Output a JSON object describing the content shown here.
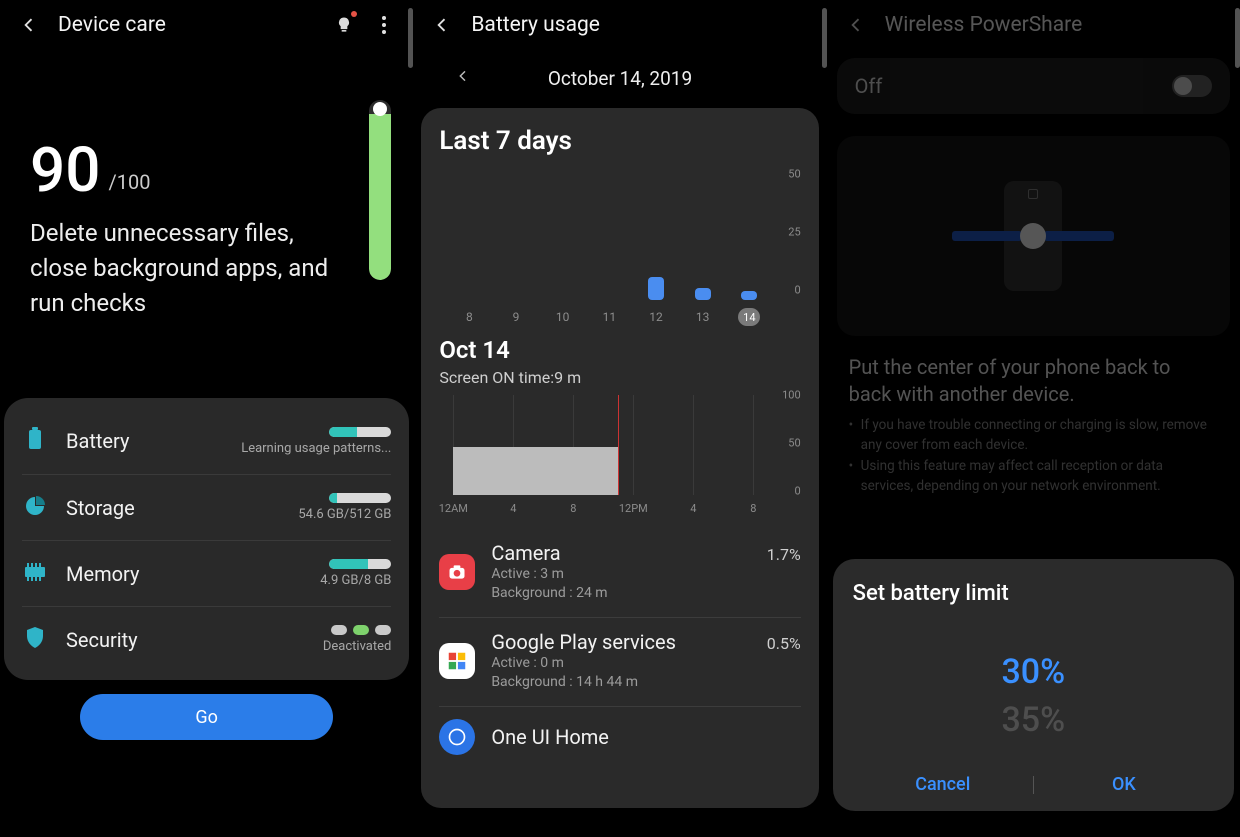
{
  "pane1": {
    "title": "Device care",
    "score": "90",
    "score_denominator": "/100",
    "advice": "Delete unnecessary files, close background apps, and run checks",
    "pill_pct": 92,
    "rows": {
      "battery": {
        "label": "Battery",
        "sub": "Learning usage patterns...",
        "bar_pct": 45
      },
      "storage": {
        "label": "Storage",
        "sub": "54.6 GB/512 GB",
        "bar_pct": 12
      },
      "memory": {
        "label": "Memory",
        "sub": "4.9 GB/8 GB",
        "bar_pct": 62
      },
      "security": {
        "label": "Security",
        "sub": "Deactivated"
      }
    },
    "go": "Go"
  },
  "pane2": {
    "title": "Battery usage",
    "date": "October 14, 2019",
    "section": "Last 7 days",
    "day_title": "Oct 14",
    "screen_on": "Screen ON time:9 m",
    "apps": [
      {
        "name": "Camera",
        "active": "Active : 3 m",
        "bg": "Background : 24 m",
        "pct": "1.7%",
        "color": "#e83f47",
        "icon": "camera"
      },
      {
        "name": "Google Play services",
        "active": "Active : 0 m",
        "bg": "Background : 14 h 44 m",
        "pct": "0.5%",
        "color": "#fff",
        "icon": "play"
      },
      {
        "name": "One UI Home",
        "active": "",
        "bg": "",
        "pct": "",
        "color": "#2b74e6",
        "icon": "home"
      }
    ]
  },
  "pane3": {
    "title": "Wireless PowerShare",
    "toggle_state": "Off",
    "desc_main": "Put the center of your phone back to back with another device.",
    "desc_list": [
      "If you have trouble connecting or charging is slow, remove any cover from each device.",
      "Using this feature may affect call reception or data services, depending on your network environment."
    ],
    "sheet": {
      "title": "Set battery limit",
      "selected": "30%",
      "next": "35%",
      "cancel": "Cancel",
      "ok": "OK"
    }
  },
  "chart_data": [
    {
      "type": "bar",
      "title": "Last 7 days",
      "categories": [
        "8",
        "9",
        "10",
        "11",
        "12",
        "13",
        "14"
      ],
      "values": [
        0,
        0,
        0,
        0,
        10,
        5,
        4
      ],
      "ylim": [
        0,
        50
      ],
      "yticks": [
        0,
        25,
        50
      ],
      "selected": "14"
    },
    {
      "type": "area",
      "title": "Oct 14",
      "xlabel_ticks": [
        "12AM",
        "4",
        "8",
        "12PM",
        "4",
        "8"
      ],
      "ylim": [
        0,
        100
      ],
      "yticks": [
        0,
        50,
        100
      ],
      "now_fraction": 0.55,
      "area_start_pct": 50,
      "area_end_pct": 46
    }
  ]
}
